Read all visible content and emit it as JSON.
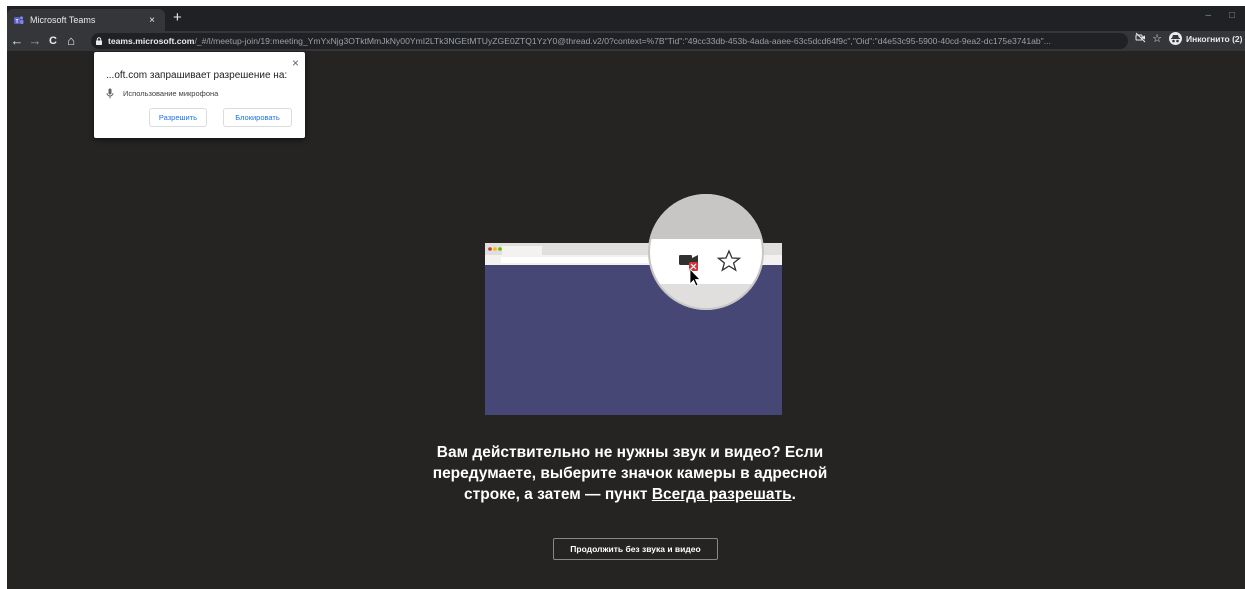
{
  "browser": {
    "tab": {
      "title": "Microsoft Teams",
      "favicon": "teams-icon",
      "close_glyph": "×"
    },
    "new_tab_glyph": "+",
    "window_controls": {
      "minimize": "–",
      "maximize": "□"
    },
    "nav": {
      "back": "←",
      "forward": "→",
      "reload": "C",
      "home": "⌂"
    },
    "address_bar": {
      "host": "teams.microsoft.com",
      "path": "/_#/l/meetup-join/19:meeting_YmYxNjg3OTktMmJkNy00YmI2LTk3NGEtMTUyZGE0ZTQ1YzY0@thread.v2/0?context=%7B\"Tid\":\"49cc33db-453b-4ada-aaee-63c5dcd64f9c\",\"Oid\":\"d4e53c95-5900-40cd-9ea2-dc175e3741ab\"..."
    },
    "toolbar_icons": {
      "camera_blocked": "camera-off-icon",
      "bookmark": "☆"
    },
    "profile_label": "Инкогнито (2)"
  },
  "permission_popup": {
    "title": "...oft.com запрашивает разрешение на:",
    "close_glyph": "×",
    "permission": "Использование микрофона",
    "allow_label": "Разрешить",
    "block_label": "Блокировать"
  },
  "main": {
    "message_part1": "Вам действительно не нужны звук и видео? Если передумаете, выберите значок камеры в адресной строке, а затем — пункт ",
    "message_link": "Всегда разрешать",
    "message_end": ".",
    "continue_label": "Продолжить без звука и видео"
  },
  "colors": {
    "page_background": "#252423",
    "illustration_panel": "#464775",
    "link_blue": "#1a73e8"
  }
}
